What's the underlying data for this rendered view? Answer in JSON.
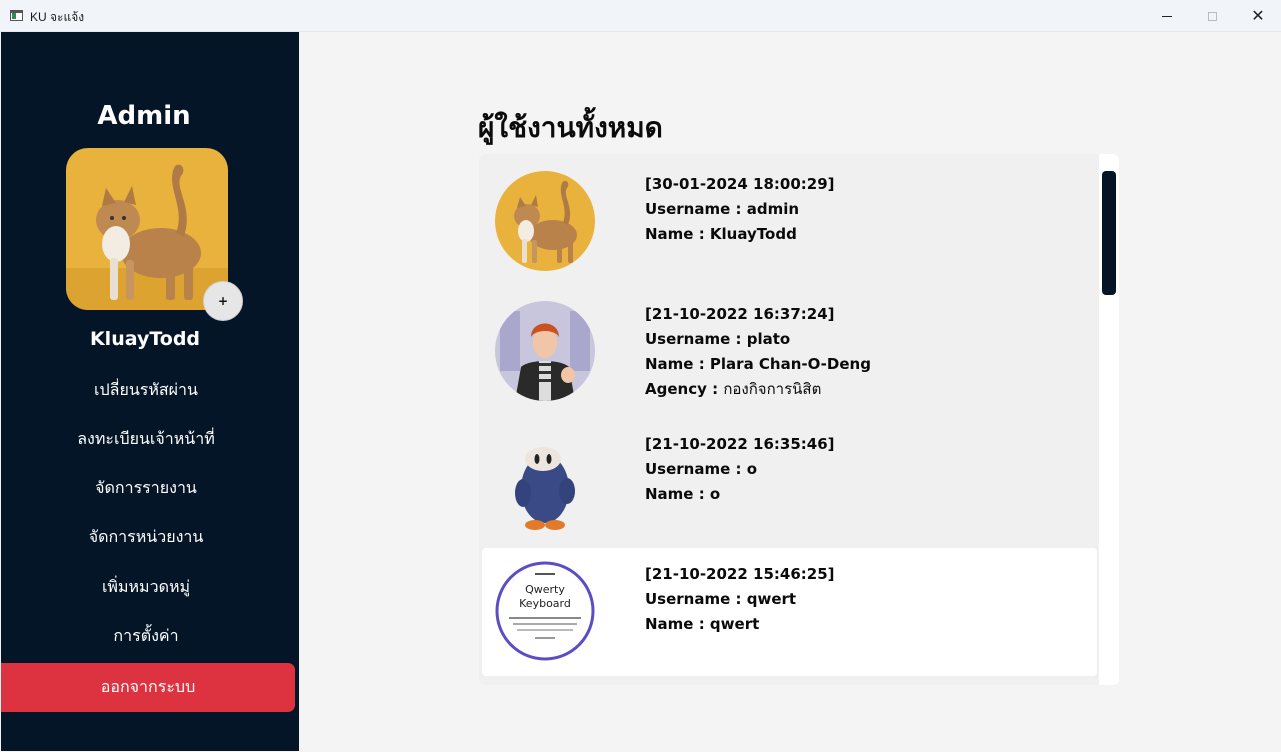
{
  "window": {
    "title": "KU จะแจ้ง",
    "minimize_icon": "minimize-icon",
    "maximize_icon": "maximize-icon",
    "close_icon": "close-icon"
  },
  "sidebar": {
    "role": "Admin",
    "add_photo_label": "+",
    "display_name": "KluayTodd",
    "items": [
      {
        "label": "เปลี่ยนรหัสผ่าน"
      },
      {
        "label": "ลงทะเบียนเจ้าหน้าที่"
      },
      {
        "label": "จัดการรายงาน"
      },
      {
        "label": "จัดการหน่วยงาน"
      },
      {
        "label": "เพิ่มหมวดหมู่"
      },
      {
        "label": "การตั้งค่า"
      }
    ],
    "logout_label": "ออกจากระบบ"
  },
  "main": {
    "heading": "ผู้ใช้งานทั้งหมด",
    "users": [
      {
        "timestamp": "[30-01-2024 18:00:29]",
        "username_label": "Username : ",
        "username": "admin",
        "name_label": "Name : ",
        "name": "KluayTodd",
        "agency_label": "",
        "agency": "",
        "avatar": "cat-photo"
      },
      {
        "timestamp": "[21-10-2022 16:37:24]",
        "username_label": "Username : ",
        "username": "plato",
        "name_label": "Name : ",
        "name": "Plara Chan-O-Deng",
        "agency_label": "Agency : ",
        "agency": "กองกิจการนิสิต",
        "avatar": "man-photo"
      },
      {
        "timestamp": "[21-10-2022 16:35:46]",
        "username_label": "Username : ",
        "username": "o",
        "name_label": "Name : ",
        "name": "o",
        "agency_label": "",
        "agency": "",
        "avatar": "blue-character"
      },
      {
        "timestamp": "[21-10-2022 15:46:25]",
        "username_label": "Username : ",
        "username": "qwert",
        "name_label": "Name : ",
        "name": "qwert",
        "agency_label": "",
        "agency": "",
        "avatar": "qwerty-keyboard-logo"
      }
    ],
    "logo_text": {
      "line1": "Qwerty",
      "line2": "Keyboard"
    }
  },
  "colors": {
    "sidebar_bg": "#041527",
    "logout_bg": "#dd3341",
    "selected_card": "#ffffff",
    "panel_bg": "#f0f0f0"
  }
}
